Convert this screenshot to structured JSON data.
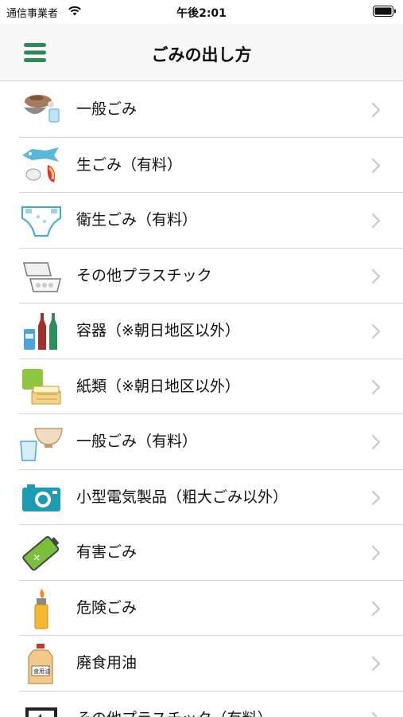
{
  "status_bar": {
    "carrier": "通信事業者",
    "time": "午後2:01"
  },
  "nav": {
    "title": "ごみの出し方",
    "menu_icon": "hamburger-menu-icon"
  },
  "colors": {
    "accent": "#2e8b57",
    "chevron": "#c7c7cc",
    "divider": "#d4d4d4"
  },
  "items": [
    {
      "label": "一般ごみ",
      "icon": "general-garbage-icon"
    },
    {
      "label": "生ごみ（有料）",
      "icon": "food-waste-icon"
    },
    {
      "label": "衛生ごみ（有料）",
      "icon": "diaper-icon"
    },
    {
      "label": "その他プラスチック",
      "icon": "plastic-container-icon"
    },
    {
      "label": "容器（※朝日地区以外）",
      "icon": "bottles-icon"
    },
    {
      "label": "紙類（※朝日地区以外）",
      "icon": "paper-icon"
    },
    {
      "label": "一般ごみ（有料）",
      "icon": "bowl-cup-icon"
    },
    {
      "label": "小型電気製品（粗大ごみ以外）",
      "icon": "camera-icon"
    },
    {
      "label": "有害ごみ",
      "icon": "battery-icon"
    },
    {
      "label": "危険ごみ",
      "icon": "lighter-icon"
    },
    {
      "label": "廃食用油",
      "icon": "oil-bottle-icon",
      "icon_text": "食用油"
    },
    {
      "label": "その他プラスチック（有料）",
      "icon": "plastic-recycle-icon"
    }
  ]
}
